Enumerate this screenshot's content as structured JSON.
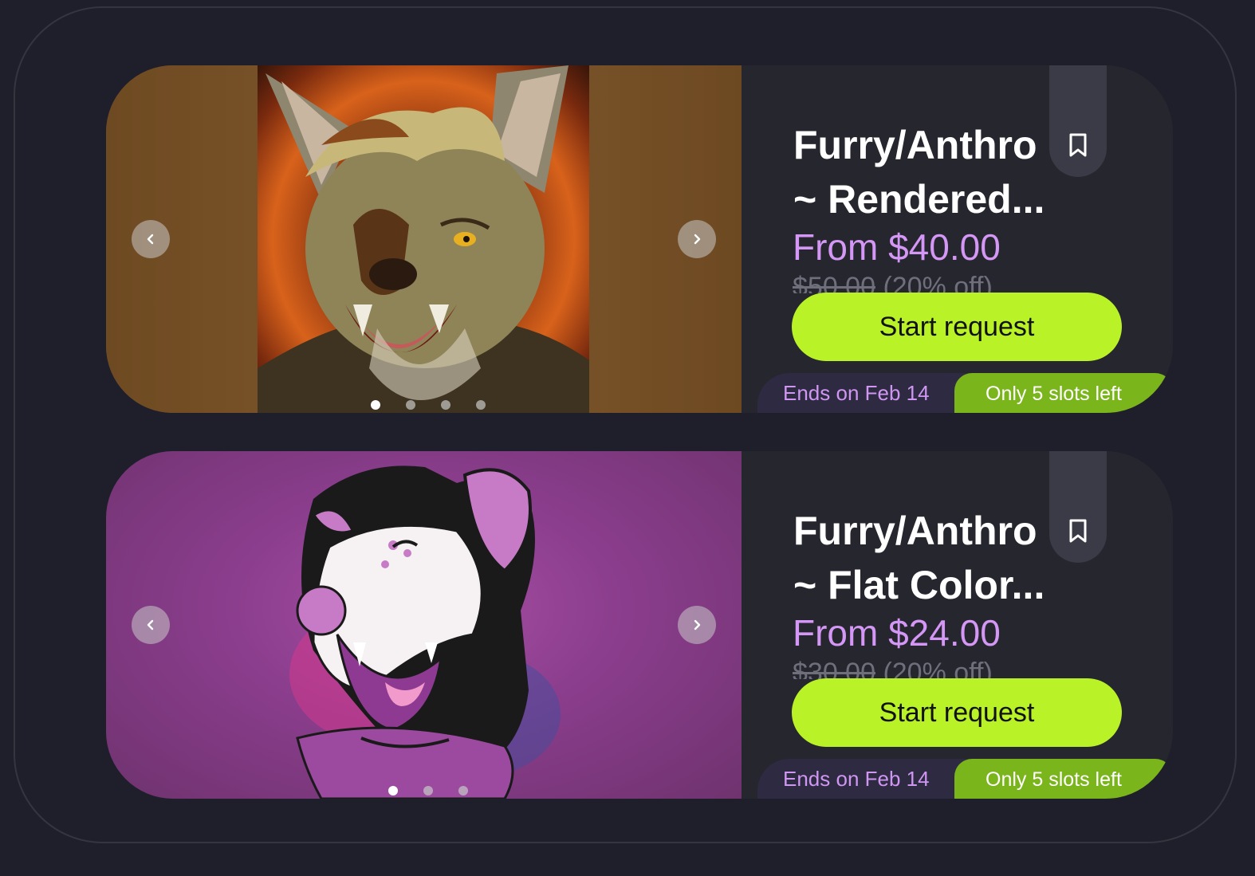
{
  "listings": [
    {
      "title_line1": "Furry/Anthro",
      "title_line2": "~ Rendered...",
      "price": "From $40.00",
      "original_price": "$50.00",
      "discount": "(20% off)",
      "cta_label": "Start request",
      "ends": "Ends on Feb 14",
      "slots": "Only 5 slots left",
      "image_count": 4,
      "active_image": 1,
      "image_background": "#7a5428"
    },
    {
      "title_line1": "Furry/Anthro",
      "title_line2": "~ Flat Color...",
      "price": "From $24.00",
      "original_price": "$30.00",
      "discount": "(20% off)",
      "cta_label": "Start request",
      "ends": "Ends on Feb 14",
      "slots": "Only 5 slots left",
      "image_count": 3,
      "active_image": 1,
      "image_background": "#8a3d8c"
    }
  ],
  "colors": {
    "page_background": "#1f1f2b",
    "card_background": "#26262f",
    "price": "#d597f5",
    "cta": "#b8f227",
    "slots_badge": "#7bb51c",
    "ends_badge": "#2e2a42"
  },
  "icons": {
    "prev": "chevron-left-icon",
    "next": "chevron-right-icon",
    "bookmark": "bookmark-icon"
  }
}
